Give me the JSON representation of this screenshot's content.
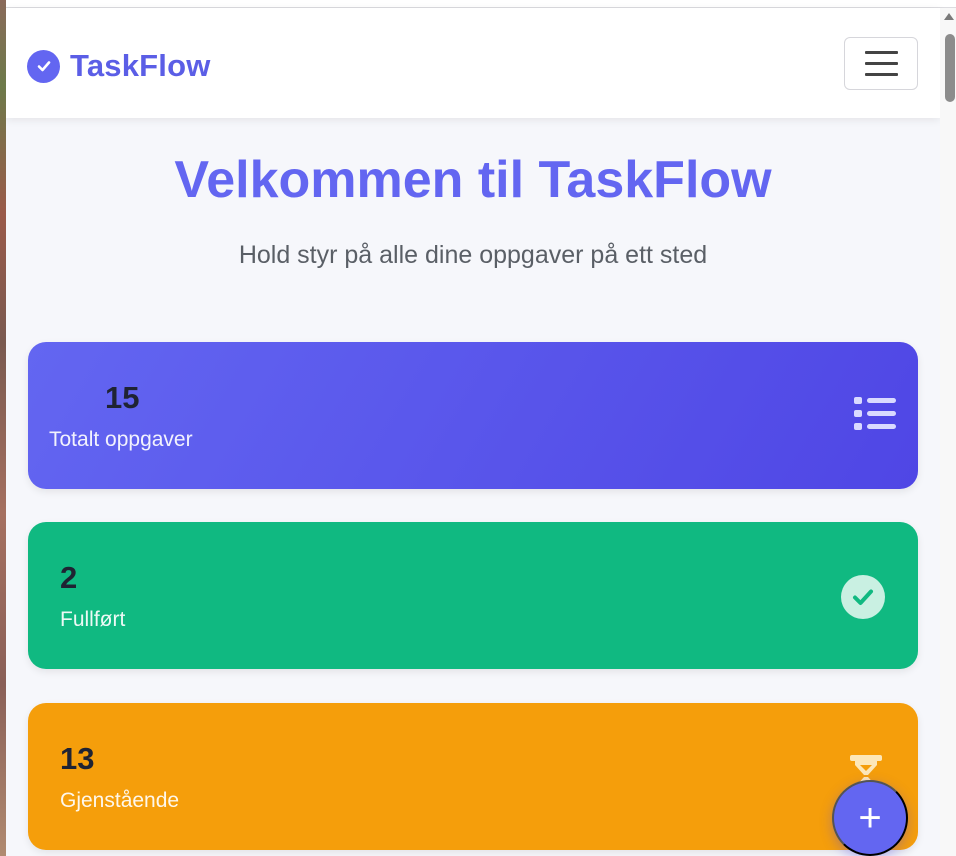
{
  "app": {
    "brand_name": "TaskFlow",
    "accent_color": "#6366f1"
  },
  "navbar": {
    "menu_icon": "hamburger-menu-icon"
  },
  "hero": {
    "title": "Velkommen til TaskFlow",
    "subtitle": "Hold styr på alle dine oppgaver på ett sted"
  },
  "stats": {
    "total": {
      "value": "15",
      "label": "Totalt oppgaver",
      "icon": "list-icon",
      "color": "#4f46e5"
    },
    "completed": {
      "value": "2",
      "label": "Fullført",
      "icon": "check-circle-icon",
      "color": "#10b981"
    },
    "remaining": {
      "value": "13",
      "label": "Gjenstående",
      "icon": "hourglass-icon",
      "color": "#f59e0b"
    }
  },
  "fab": {
    "label": "+",
    "icon": "plus-icon"
  }
}
